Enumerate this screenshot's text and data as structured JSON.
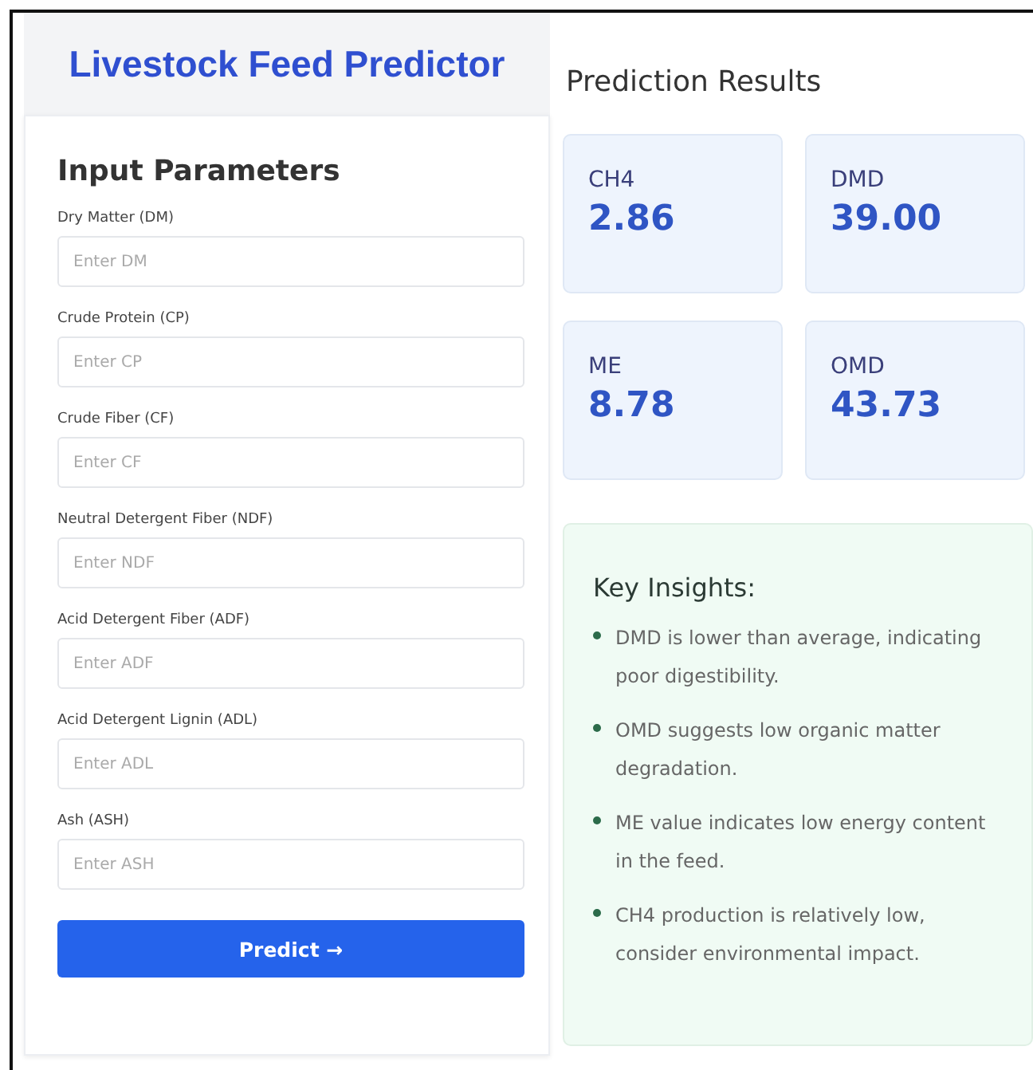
{
  "header": {
    "title": "Livestock Feed Predictor"
  },
  "input_panel": {
    "title": "Input Parameters",
    "fields": [
      {
        "label": "Dry Matter (DM)",
        "placeholder": "Enter DM"
      },
      {
        "label": "Crude Protein (CP)",
        "placeholder": "Enter CP"
      },
      {
        "label": "Crude Fiber (CF)",
        "placeholder": "Enter CF"
      },
      {
        "label": "Neutral Detergent Fiber (NDF)",
        "placeholder": "Enter NDF"
      },
      {
        "label": "Acid Detergent Fiber (ADF)",
        "placeholder": "Enter ADF"
      },
      {
        "label": "Acid Detergent Lignin (ADL)",
        "placeholder": "Enter ADL"
      },
      {
        "label": "Ash (ASH)",
        "placeholder": "Enter ASH"
      }
    ],
    "button": "Predict →"
  },
  "results": {
    "title": "Prediction Results",
    "cards": [
      {
        "label": "CH4",
        "value": "2.86"
      },
      {
        "label": "DMD",
        "value": "39.00"
      },
      {
        "label": "ME",
        "value": "8.78"
      },
      {
        "label": "OMD",
        "value": "43.73"
      }
    ]
  },
  "insights": {
    "title": "Key Insights:",
    "items": [
      "DMD is lower than average, indicating poor digestibility.",
      "OMD suggests low organic matter degradation.",
      "ME value indicates low energy content in the feed.",
      "CH4 production is relatively low, consider environmental impact."
    ]
  }
}
